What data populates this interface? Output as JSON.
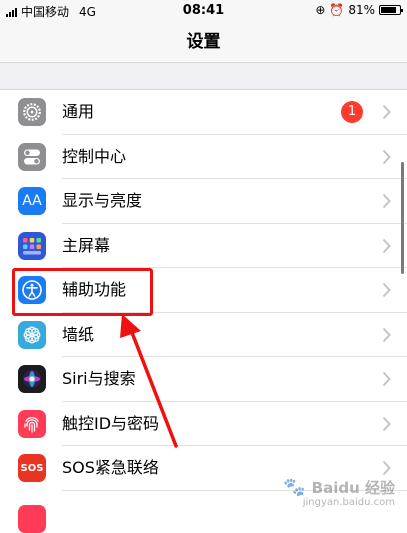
{
  "status_bar": {
    "carrier": "中国移动",
    "network": "4G",
    "time": "08:41",
    "battery_percent_label": "81%",
    "battery_level": 0.81
  },
  "nav": {
    "title": "设置"
  },
  "settings_items": [
    {
      "label": "通用",
      "icon": "gear-icon",
      "icon_color": "#8e8e93",
      "badge": "1"
    },
    {
      "label": "控制中心",
      "icon": "toggles-icon",
      "icon_color": "#8e8e93"
    },
    {
      "label": "显示与亮度",
      "icon": "display-brightness-icon",
      "icon_color": "#1a7cf5",
      "icon_text": "AA"
    },
    {
      "label": "主屏幕",
      "icon": "home-screen-icon",
      "icon_color": "#2f58d8"
    },
    {
      "label": "辅助功能",
      "icon": "accessibility-icon",
      "icon_color": "#1a7cf5"
    },
    {
      "label": "墙纸",
      "icon": "wallpaper-flower-icon",
      "icon_color": "#35aadc"
    },
    {
      "label": "Siri与搜索",
      "icon": "siri-icon",
      "icon_color": "#1c1c1e"
    },
    {
      "label": "触控ID与密码",
      "icon": "fingerprint-icon",
      "icon_color": "#ff3b55"
    },
    {
      "label": "SOS紧急联络",
      "icon": "sos-icon",
      "icon_color": "#e93323",
      "icon_text": "SOS"
    }
  ],
  "annotation": {
    "highlight_color": "#f01010"
  },
  "watermark": {
    "text": "Baidu 经验",
    "subtext": "jingyan.baidu.com"
  }
}
